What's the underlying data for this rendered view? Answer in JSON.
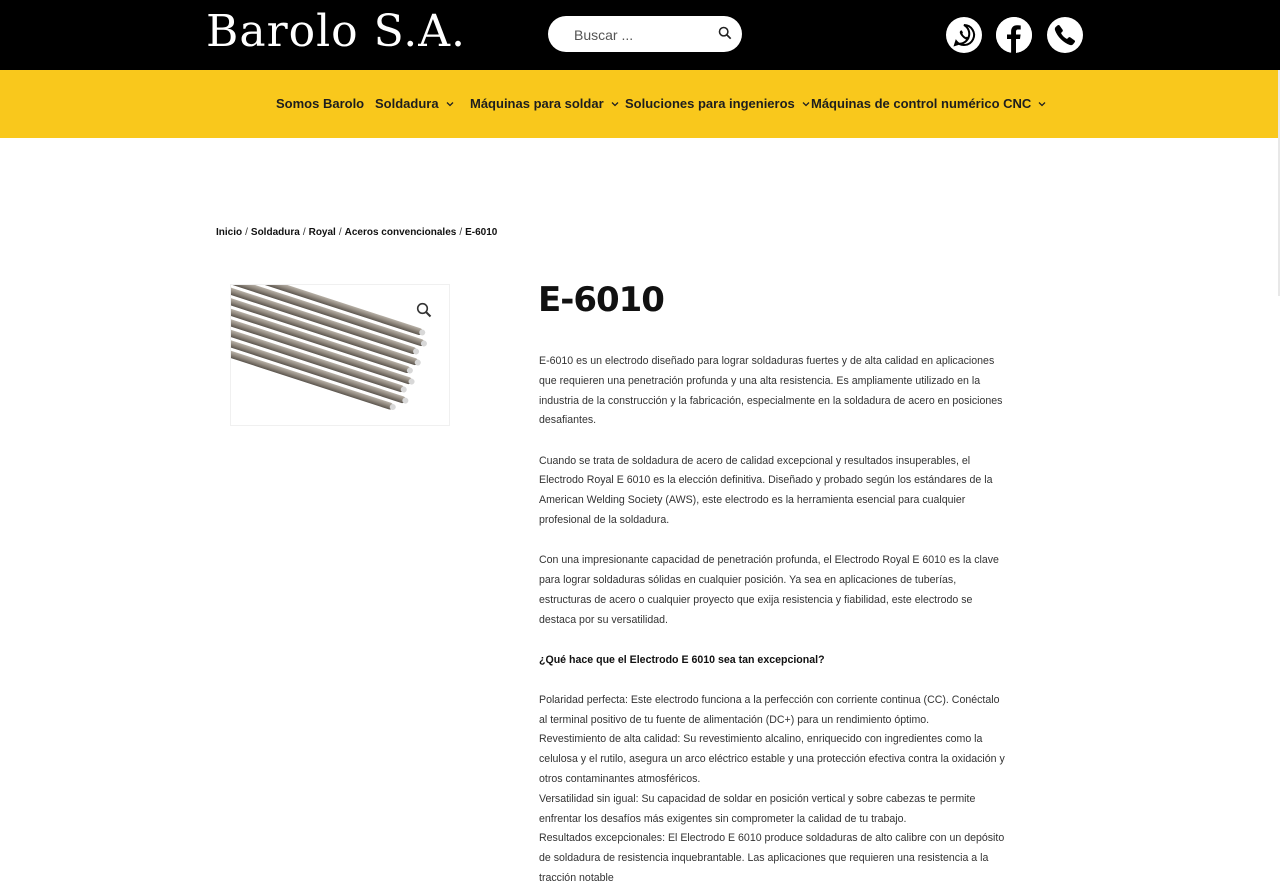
{
  "header": {
    "logo_text": "Barolo S.A.",
    "search_placeholder": "Buscar ...",
    "social": [
      "whatsapp-icon",
      "facebook-icon",
      "phone-icon"
    ]
  },
  "nav": {
    "items": [
      {
        "label": "Somos Barolo",
        "dropdown": false
      },
      {
        "label": "Soldadura",
        "dropdown": true
      },
      {
        "label": "Máquinas para soldar",
        "dropdown": true
      },
      {
        "label": "Soluciones para ingenieros",
        "dropdown": true
      },
      {
        "label": "Máquinas de control numérico CNC",
        "dropdown": true
      }
    ]
  },
  "breadcrumb": [
    "Inicio",
    "Soldadura",
    "Royal",
    "Aceros convencionales",
    "E-6010"
  ],
  "product": {
    "title": "E-6010",
    "paragraphs": [
      "E-6010 es un electrodo diseñado para lograr soldaduras fuertes y de alta calidad en aplicaciones que requieren una penetración profunda y una alta resistencia. Es ampliamente utilizado en la industria de la construcción y la fabricación, especialmente en la soldadura de acero en posiciones desafiantes.",
      "Cuando se trata de soldadura de acero de calidad excepcional y resultados insuperables, el Electrodo Royal E 6010 es la elección definitiva. Diseñado y probado según los estándares de la American Welding Society (AWS), este electrodo es la herramienta esencial para cualquier profesional de la soldadura.",
      "Con una impresionante capacidad de penetración profunda, el Electrodo Royal E 6010 es la clave para lograr soldaduras sólidas en cualquier posición. Ya sea en aplicaciones de tuberías, estructuras de acero o cualquier proyecto que exija resistencia y fiabilidad, este electrodo se destaca por su versatilidad."
    ],
    "question": "¿Qué hace que el Electrodo E 6010 sea tan excepcional?",
    "features": [
      "Polaridad perfecta: Este electrodo funciona a la perfección con corriente continua (CC). Conéctalo al terminal positivo de tu fuente de alimentación (DC+) para un rendimiento óptimo.",
      "Revestimiento de alta calidad: Su revestimiento alcalino, enriquecido con ingredientes como la celulosa y el rutilo, asegura un arco eléctrico estable y una protección efectiva contra la oxidación y otros contaminantes atmosféricos.",
      "Versatilidad sin igual: Su capacidad de soldar en posición vertical y sobre cabezas te permite enfrentar los desafíos más exigentes sin comprometer la calidad de tu trabajo.",
      "Resultados excepcionales: El Electrodo E 6010 produce soldaduras de alto calibre con un depósito de soldadura de resistencia inquebrantable. Las aplicaciones que requieren una resistencia a la tracción notable"
    ]
  },
  "colors": {
    "header_bg": "#000000",
    "nav_bg": "#F9C81C",
    "text": "#333333"
  }
}
